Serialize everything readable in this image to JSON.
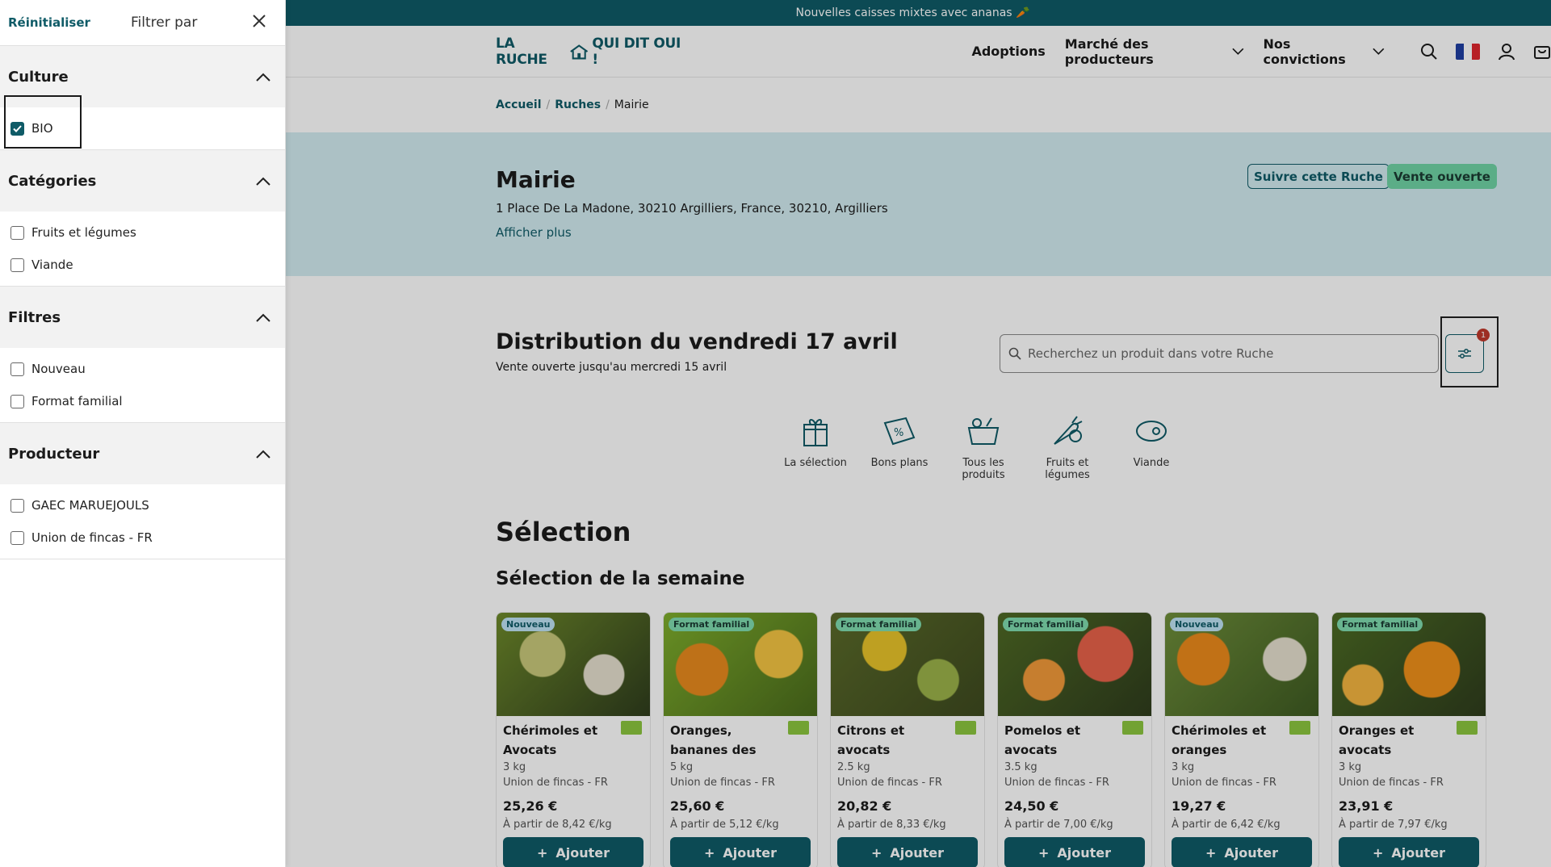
{
  "announcement": "Nouvelles caisses mixtes avec ananas 🥕",
  "logo": {
    "left": "LA RUCHE",
    "right": "QUI DIT OUI !"
  },
  "nav": {
    "adoptions": "Adoptions",
    "market": "Marché des producteurs",
    "convictions": "Nos convictions"
  },
  "icons": [
    "search-icon",
    "flag-fr-icon",
    "user-icon",
    "cart-icon"
  ],
  "breadcrumb": {
    "home": "Accueil",
    "sep": "/",
    "ruches": "Ruches",
    "current": "Mairie"
  },
  "hive": {
    "name": "Mairie",
    "address": "1 Place De La Madone, 30210 Argilliers, France, 30210, Argilliers",
    "more": "Afficher plus",
    "follow": "Suivre cette Ruche",
    "status": "Vente ouverte"
  },
  "distribution": {
    "title": "Distribution du vendredi 17 avril",
    "subtitle": "Vente ouverte jusqu'au mercredi 15 avril",
    "search_placeholder": "Recherchez un produit dans votre Ruche",
    "filter_count": "1"
  },
  "categories": [
    {
      "label": "La sélection",
      "icon": "gift-box-icon"
    },
    {
      "label": "Bons plans",
      "icon": "discount-tag-icon"
    },
    {
      "label": "Tous les produits",
      "icon": "basket-icon"
    },
    {
      "label": "Fruits et légumes",
      "icon": "vegetables-icon"
    },
    {
      "label": "Viande",
      "icon": "meat-icon"
    }
  ],
  "selection": {
    "title": "Sélection",
    "subtitle": "Sélection de la semaine"
  },
  "products": [
    {
      "tag": "Nouveau",
      "tag_type": "new",
      "name": "Chérimoles et Avocats",
      "weight": "3 kg",
      "producer": "Union de fincas - FR",
      "price": "25,26 €",
      "unit": "À partir de 8,42 €/kg",
      "add": "Ajouter",
      "colors": [
        "#6e8a2b",
        "#c9c97a",
        "#2f3d1d"
      ]
    },
    {
      "tag": "Format familial",
      "tag_type": "fam",
      "name": "Oranges, bananes des Canaries et...",
      "weight": "5 kg",
      "producer": "Union de fincas - FR",
      "price": "25,60 €",
      "unit": "À partir de 5,12 €/kg",
      "add": "Ajouter",
      "colors": [
        "#e88a1e",
        "#7fae2c",
        "#f4c542"
      ]
    },
    {
      "tag": "Format familial",
      "tag_type": "fam",
      "name": "Citrons et avocats",
      "weight": "2.5 kg",
      "producer": "Union de fincas - FR",
      "price": "20,82 €",
      "unit": "À partir de 8,33 €/kg",
      "add": "Ajouter",
      "colors": [
        "#e8c42a",
        "#3e4a1f",
        "#9bb24a"
      ]
    },
    {
      "tag": "Format familial",
      "tag_type": "fam",
      "name": "Pomelos et avocats",
      "weight": "3.5 kg",
      "producer": "Union de fincas - FR",
      "price": "24,50 €",
      "unit": "À partir de 7,00 €/kg",
      "add": "Ajouter",
      "colors": [
        "#e8624a",
        "#f29a3a",
        "#4f6a25"
      ]
    },
    {
      "tag": "Nouveau",
      "tag_type": "new",
      "name": "Chérimoles et oranges",
      "weight": "3 kg",
      "producer": "Union de fincas - FR",
      "price": "19,27 €",
      "unit": "À partir de 6,42 €/kg",
      "add": "Ajouter",
      "colors": [
        "#ec8a1c",
        "#6f8f3a",
        "#e6e0cf"
      ]
    },
    {
      "tag": "Format familial",
      "tag_type": "fam",
      "name": "Oranges et avocats",
      "weight": "3 kg",
      "producer": "Union de fincas - FR",
      "price": "23,91 €",
      "unit": "À partir de 7,97 €/kg",
      "add": "Ajouter",
      "colors": [
        "#f0901a",
        "#4c6b24",
        "#f5b540"
      ]
    }
  ],
  "drawer": {
    "reset": "Réinitialiser",
    "title": "Filtrer par",
    "sections": [
      {
        "title": "Culture",
        "options": [
          {
            "label": "BIO",
            "checked": true
          }
        ]
      },
      {
        "title": "Catégories",
        "options": [
          {
            "label": "Fruits et légumes",
            "checked": false
          },
          {
            "label": "Viande",
            "checked": false
          }
        ]
      },
      {
        "title": "Filtres",
        "options": [
          {
            "label": "Nouveau",
            "checked": false
          },
          {
            "label": "Format familial",
            "checked": false
          }
        ]
      },
      {
        "title": "Producteur",
        "options": [
          {
            "label": "GAEC MARUEJOULS",
            "checked": false
          },
          {
            "label": "Union de fincas - FR",
            "checked": false
          }
        ]
      }
    ]
  },
  "colors": {
    "brand": "#0f5b67",
    "hero_bg": "#d2ecf1",
    "open_badge": "#6fd3a5"
  }
}
